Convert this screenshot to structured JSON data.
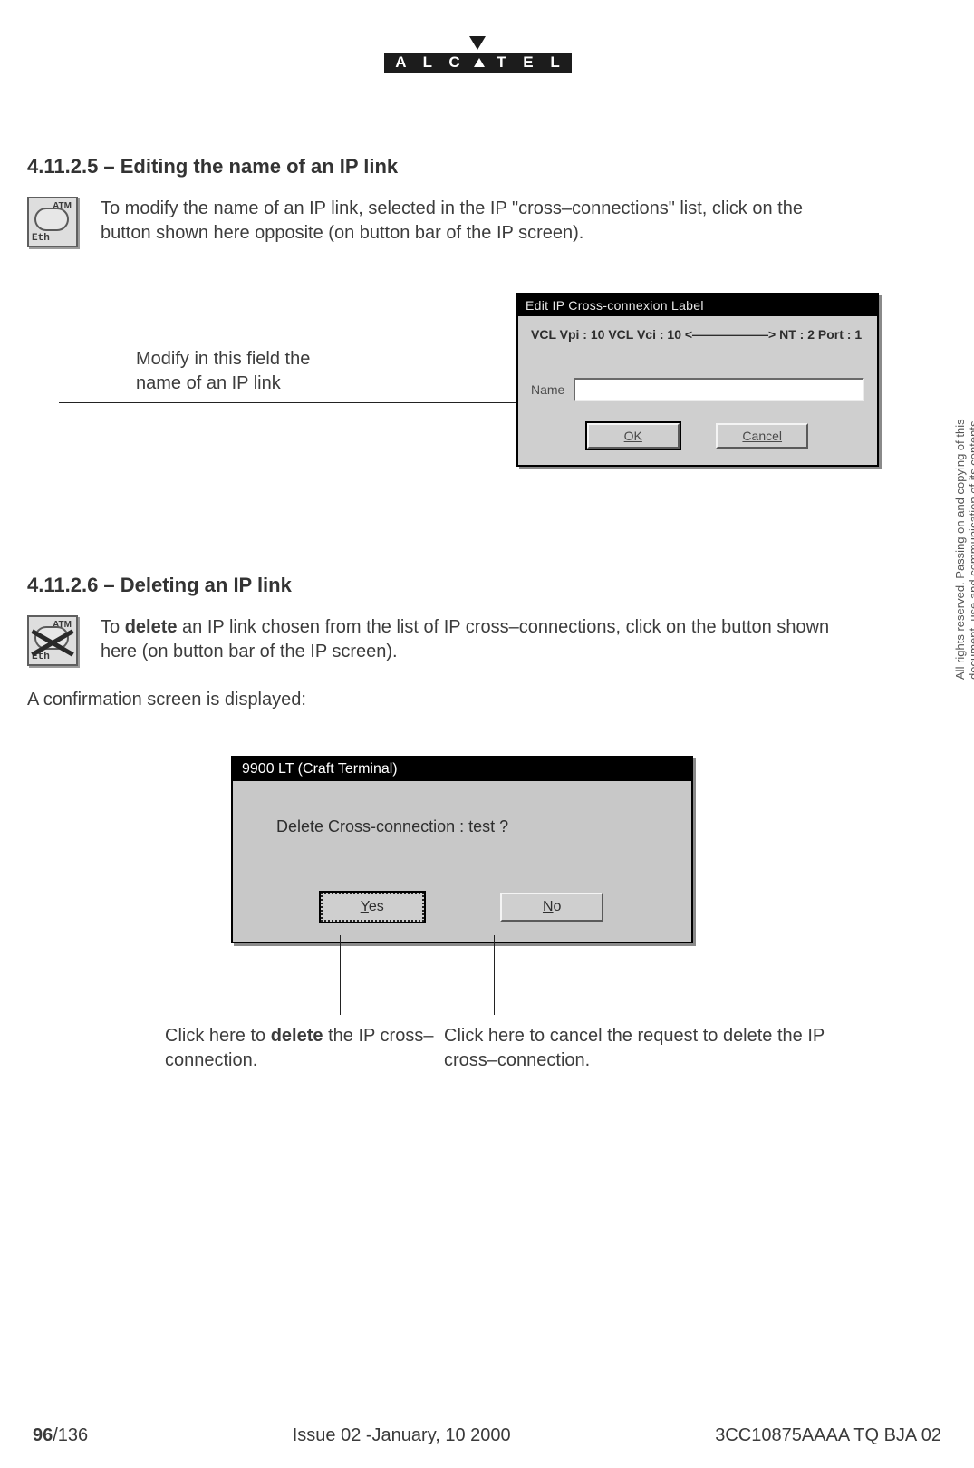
{
  "brand": "ALCATEL",
  "sections": {
    "s1_title": "4.11.2.5 – Editing the name of an IP link",
    "s1_body": "To modify the name of an IP link, selected in the IP \"cross–connections\" list, click on the button shown here opposite (on button bar of the IP screen).",
    "s1_callout": "Modify in this field the\nname of an IP link",
    "s2_title": "4.11.2.6 – Deleting an IP link",
    "s2_body_prefix": "To ",
    "s2_body_bold": "delete",
    "s2_body_suffix": " an IP link chosen from the list of IP cross–connections, click on the button shown here (on button bar of the IP screen).",
    "s2_confirm_intro": "A confirmation screen is displayed:",
    "s2_callout_yes_prefix": "Click here to ",
    "s2_callout_yes_bold": "delete",
    "s2_callout_yes_suffix": " the IP cross–connection.",
    "s2_callout_no": "Click here to cancel the request to delete the IP cross–connection."
  },
  "dialog_edit": {
    "title": "Edit IP Cross-connexion Label",
    "vcl_line": "VCL Vpi : 10 VCL Vci : 10 <——————> NT : 2 Port : 1",
    "field_label": "Name",
    "ok": "OK",
    "cancel": "Cancel"
  },
  "dialog_confirm": {
    "title": "9900 LT (Craft Terminal)",
    "message": "Delete Cross-connection : test ?",
    "yes": "Yes",
    "no": "No"
  },
  "side_rights": "All rights reserved. Passing on and copying of this\ndocument, use and communication of its contents\nnot permitted without written authorization from ALCATEL",
  "footer": {
    "page_bold": "96",
    "page_rest": "/136",
    "issue": "Issue 02 -January, 10 2000",
    "doc": "3CC10875AAAA TQ BJA 02"
  }
}
